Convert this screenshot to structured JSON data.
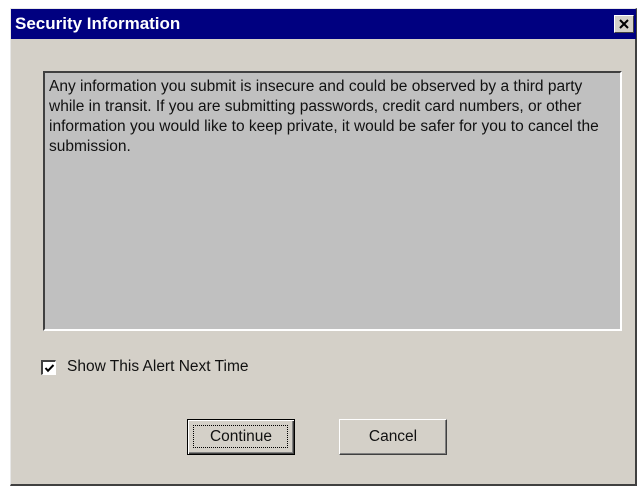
{
  "dialog": {
    "title": "Security Information",
    "close_icon": "close-icon",
    "message": "Any information you submit is insecure and could be observed by a third party while in transit. If you are submitting passwords, credit card numbers, or other information you would like to keep private, it would be safer for you to cancel the submission.",
    "checkbox": {
      "label": "Show This Alert Next Time",
      "checked": true,
      "icon": "checkmark-icon"
    },
    "buttons": {
      "continue_label": "Continue",
      "cancel_label": "Cancel"
    }
  },
  "colors": {
    "titlebar": "#000080",
    "title_text": "#ffffff",
    "dialog_face": "#d4d0c8",
    "message_panel": "#c0c0c0",
    "text": "#111111"
  }
}
